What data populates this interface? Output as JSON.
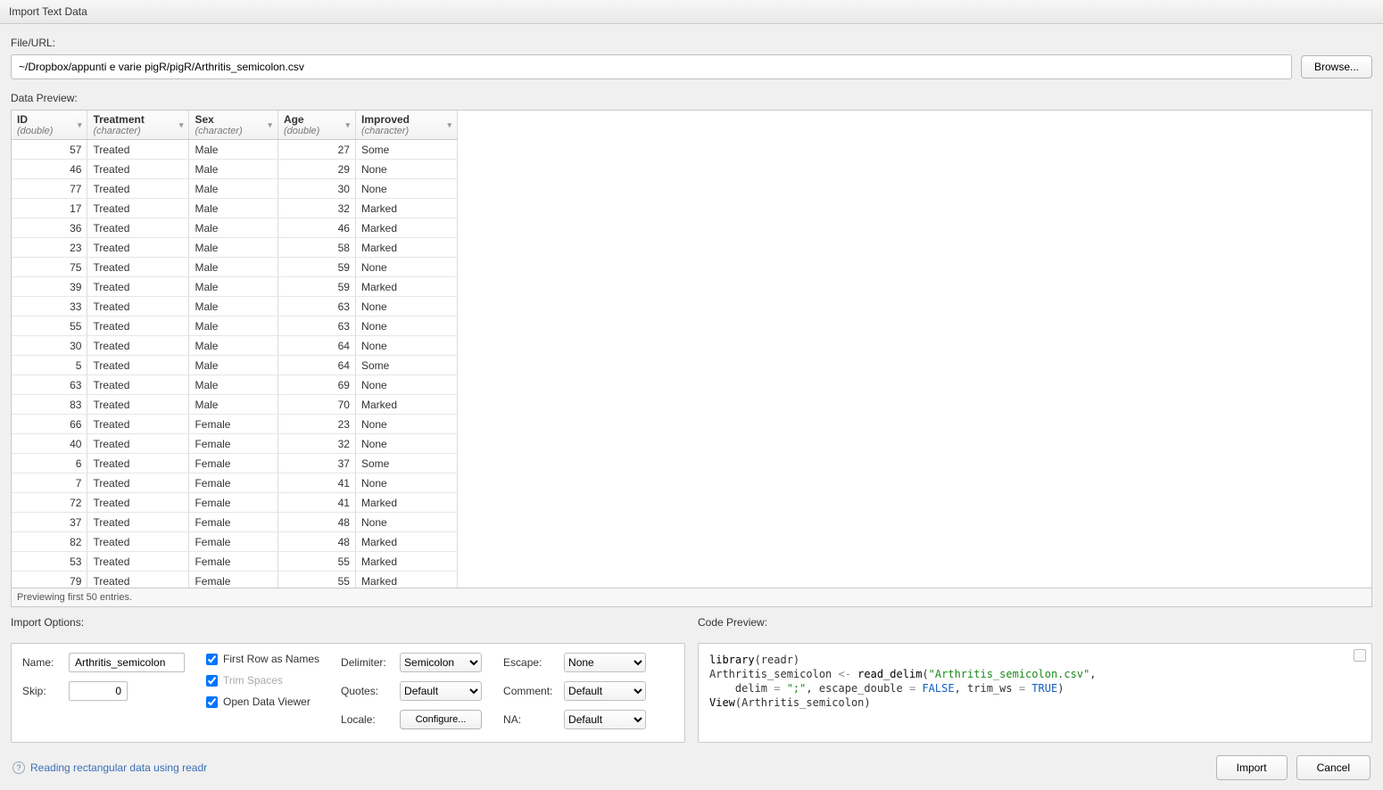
{
  "window": {
    "title": "Import Text Data"
  },
  "file": {
    "label": "File/URL:",
    "value": "~/Dropbox/appunti e varie pigR/pigR/Arthritis_semicolon.csv",
    "browse": "Browse..."
  },
  "preview": {
    "label": "Data Preview:",
    "footer": "Previewing first 50 entries.",
    "columns": [
      {
        "name": "ID",
        "type": "(double)",
        "align": "num"
      },
      {
        "name": "Treatment",
        "type": "(character)",
        "align": ""
      },
      {
        "name": "Sex",
        "type": "(character)",
        "align": ""
      },
      {
        "name": "Age",
        "type": "(double)",
        "align": "num"
      },
      {
        "name": "Improved",
        "type": "(character)",
        "align": ""
      }
    ],
    "rows": [
      [
        "57",
        "Treated",
        "Male",
        "27",
        "Some"
      ],
      [
        "46",
        "Treated",
        "Male",
        "29",
        "None"
      ],
      [
        "77",
        "Treated",
        "Male",
        "30",
        "None"
      ],
      [
        "17",
        "Treated",
        "Male",
        "32",
        "Marked"
      ],
      [
        "36",
        "Treated",
        "Male",
        "46",
        "Marked"
      ],
      [
        "23",
        "Treated",
        "Male",
        "58",
        "Marked"
      ],
      [
        "75",
        "Treated",
        "Male",
        "59",
        "None"
      ],
      [
        "39",
        "Treated",
        "Male",
        "59",
        "Marked"
      ],
      [
        "33",
        "Treated",
        "Male",
        "63",
        "None"
      ],
      [
        "55",
        "Treated",
        "Male",
        "63",
        "None"
      ],
      [
        "30",
        "Treated",
        "Male",
        "64",
        "None"
      ],
      [
        "5",
        "Treated",
        "Male",
        "64",
        "Some"
      ],
      [
        "63",
        "Treated",
        "Male",
        "69",
        "None"
      ],
      [
        "83",
        "Treated",
        "Male",
        "70",
        "Marked"
      ],
      [
        "66",
        "Treated",
        "Female",
        "23",
        "None"
      ],
      [
        "40",
        "Treated",
        "Female",
        "32",
        "None"
      ],
      [
        "6",
        "Treated",
        "Female",
        "37",
        "Some"
      ],
      [
        "7",
        "Treated",
        "Female",
        "41",
        "None"
      ],
      [
        "72",
        "Treated",
        "Female",
        "41",
        "Marked"
      ],
      [
        "37",
        "Treated",
        "Female",
        "48",
        "None"
      ],
      [
        "82",
        "Treated",
        "Female",
        "48",
        "Marked"
      ],
      [
        "53",
        "Treated",
        "Female",
        "55",
        "Marked"
      ],
      [
        "79",
        "Treated",
        "Female",
        "55",
        "Marked"
      ]
    ]
  },
  "options": {
    "label": "Import Options:",
    "name_label": "Name:",
    "name_value": "Arthritis_semicolon",
    "skip_label": "Skip:",
    "skip_value": "0",
    "first_row": "First Row as Names",
    "trim_spaces": "Trim Spaces",
    "open_viewer": "Open Data Viewer",
    "delimiter_label": "Delimiter:",
    "delimiter_value": "Semicolon",
    "quotes_label": "Quotes:",
    "quotes_value": "Default",
    "locale_label": "Locale:",
    "locale_button": "Configure...",
    "escape_label": "Escape:",
    "escape_value": "None",
    "comment_label": "Comment:",
    "comment_value": "Default",
    "na_label": "NA:",
    "na_value": "Default"
  },
  "code": {
    "label": "Code Preview:",
    "l1a": "library",
    "l1b": "(readr)",
    "l2a": "Arthritis_semicolon ",
    "l2b": "<-",
    "l2c": " read_delim",
    "l2d": "(",
    "l2e": "\"Arthritis_semicolon.csv\"",
    "l2f": ",",
    "l3a": "    delim ",
    "l3b": "=",
    "l3c": " \";\"",
    "l3d": ", escape_double ",
    "l3e": "=",
    "l3f": " FALSE",
    "l3g": ", trim_ws ",
    "l3h": "=",
    "l3i": " TRUE",
    "l3j": ")",
    "l4a": "View",
    "l4b": "(Arthritis_semicolon)"
  },
  "footer": {
    "help": "Reading rectangular data using readr",
    "import": "Import",
    "cancel": "Cancel"
  }
}
